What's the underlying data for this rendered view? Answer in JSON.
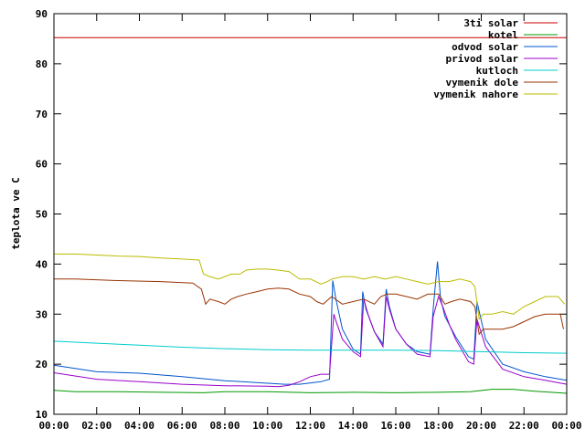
{
  "chart_data": {
    "type": "line",
    "title": "",
    "xlabel": "",
    "ylabel": "teplota ve C",
    "xlim": [
      0,
      24
    ],
    "ylim": [
      10,
      90
    ],
    "grid": false,
    "legend_position": "top-right",
    "x_ticks": [
      "00:00",
      "02:00",
      "04:00",
      "06:00",
      "08:00",
      "10:00",
      "12:00",
      "14:00",
      "16:00",
      "18:00",
      "20:00",
      "22:00",
      "00:00"
    ],
    "y_ticks": [
      "10",
      "20",
      "30",
      "40",
      "50",
      "60",
      "70",
      "80",
      "90"
    ],
    "series": [
      {
        "name": "3ti solar",
        "color": "#cc0000",
        "x": [
          0,
          24
        ],
        "y": [
          85.2,
          85.2
        ]
      },
      {
        "name": "kotel",
        "color": "#009900",
        "x": [
          0,
          1,
          3,
          5,
          7,
          8,
          10,
          12,
          14,
          16,
          18,
          19.5,
          20.5,
          21.5,
          22.5,
          24
        ],
        "y": [
          14.8,
          14.5,
          14.5,
          14.4,
          14.3,
          14.5,
          14.5,
          14.3,
          14.4,
          14.3,
          14.4,
          14.5,
          15,
          15,
          14.6,
          14.2
        ]
      },
      {
        "name": "odvod solar",
        "color": "#0055cc",
        "x": [
          0,
          2,
          4,
          6,
          8,
          10,
          10.8,
          11.5,
          12.5,
          12.9,
          13.05,
          13.2,
          13.5,
          14,
          14.35,
          14.45,
          14.6,
          15,
          15.4,
          15.55,
          15.7,
          16,
          16.5,
          17,
          17.6,
          17.75,
          17.95,
          18.1,
          18.3,
          18.8,
          19.4,
          19.65,
          19.8,
          20.2,
          21,
          22,
          23,
          24
        ],
        "y": [
          19.8,
          18.5,
          18.2,
          17.5,
          16.7,
          16.2,
          16.0,
          16.0,
          16.5,
          17.0,
          36.7,
          33.0,
          27.0,
          23.0,
          22.0,
          34.5,
          31.0,
          26.5,
          24.0,
          35.0,
          31.5,
          27.0,
          24.0,
          22.5,
          22.0,
          31.0,
          40.5,
          33.0,
          29.5,
          25.5,
          21.5,
          21.0,
          32.5,
          25.0,
          20.0,
          18.5,
          17.5,
          16.8
        ]
      },
      {
        "name": "privod solar",
        "color": "#9900cc",
        "x": [
          0,
          2,
          4,
          6,
          8,
          10,
          10.5,
          11,
          11.5,
          12,
          12.5,
          12.9,
          13.1,
          13.25,
          13.5,
          14,
          14.35,
          14.5,
          14.7,
          15,
          15.4,
          15.55,
          15.7,
          16,
          16.5,
          17,
          17.6,
          17.75,
          18,
          18.2,
          18.5,
          18.8,
          19.4,
          19.65,
          19.8,
          20.2,
          21,
          22,
          23,
          24
        ],
        "y": [
          18.3,
          17.0,
          16.5,
          16.0,
          15.7,
          15.6,
          15.5,
          15.8,
          16.5,
          17.5,
          18.0,
          18.0,
          30.0,
          28.0,
          25.0,
          22.5,
          21.5,
          33.0,
          30.0,
          26.5,
          23.5,
          33.5,
          31.0,
          27.0,
          24.0,
          22.0,
          21.5,
          29.5,
          33.5,
          31.5,
          28.0,
          25.0,
          20.5,
          20.0,
          29.0,
          23.5,
          19.0,
          17.5,
          16.8,
          16.0
        ]
      },
      {
        "name": "kutloch",
        "color": "#00cccc",
        "x": [
          0,
          2,
          4,
          6,
          8,
          10,
          12,
          14,
          16,
          18,
          20,
          22,
          24
        ],
        "y": [
          24.6,
          24.2,
          23.8,
          23.4,
          23.1,
          22.9,
          22.8,
          22.8,
          22.8,
          22.7,
          22.5,
          22.3,
          22.2
        ]
      },
      {
        "name": "vymenik dole",
        "color": "#993300",
        "x": [
          0,
          1,
          3,
          5,
          6.5,
          6.9,
          7.1,
          7.3,
          7.7,
          8.0,
          8.3,
          8.6,
          9.0,
          9.5,
          10,
          10.5,
          11,
          11.5,
          12,
          12.3,
          12.6,
          13,
          13.5,
          14,
          14.5,
          15,
          15.3,
          15.6,
          16,
          16.5,
          17,
          17.5,
          18,
          18.3,
          18.6,
          19,
          19.5,
          19.7,
          19.9,
          20.1,
          20.5,
          21,
          21.5,
          22,
          22.5,
          23,
          23.7,
          23.85
        ],
        "y": [
          37.0,
          37.0,
          36.7,
          36.5,
          36.2,
          35.0,
          32.0,
          33.0,
          32.5,
          32.0,
          33.0,
          33.5,
          34.0,
          34.5,
          35.0,
          35.2,
          35.0,
          34.0,
          33.5,
          32.5,
          32.0,
          33.5,
          32.0,
          32.5,
          33.0,
          32.0,
          33.5,
          34.0,
          34.0,
          33.5,
          33.0,
          34.0,
          34.0,
          32.0,
          32.5,
          33.0,
          32.5,
          31.5,
          26.0,
          27.0,
          27.0,
          27.0,
          27.5,
          28.5,
          29.5,
          30.0,
          30.0,
          27.0
        ]
      },
      {
        "name": "vymenik nahore",
        "color": "#bbbb00",
        "x": [
          0,
          1,
          2,
          3,
          4,
          5,
          6,
          6.8,
          7.0,
          7.3,
          7.7,
          8.0,
          8.3,
          8.7,
          9.0,
          9.5,
          10,
          10.5,
          11,
          11.5,
          12,
          12.5,
          12.8,
          13,
          13.5,
          14,
          14.5,
          15,
          15.5,
          16,
          16.5,
          17,
          17.5,
          18,
          18.5,
          19,
          19.5,
          19.7,
          19.9,
          20.1,
          20.5,
          21,
          21.5,
          22,
          22.5,
          23,
          23.6,
          23.9
        ],
        "y": [
          42.0,
          42.0,
          41.8,
          41.6,
          41.5,
          41.2,
          41.0,
          40.8,
          38.0,
          37.5,
          37.0,
          37.5,
          38.0,
          38.0,
          38.8,
          39.0,
          39.0,
          38.8,
          38.5,
          37.0,
          37.0,
          36.0,
          36.5,
          37.0,
          37.5,
          37.5,
          37.0,
          37.5,
          37.0,
          37.5,
          37.0,
          36.5,
          36.0,
          36.5,
          36.5,
          37.0,
          36.5,
          35.5,
          29.0,
          30.0,
          30.0,
          30.5,
          30.0,
          31.5,
          32.5,
          33.5,
          33.5,
          32.0
        ]
      }
    ]
  }
}
